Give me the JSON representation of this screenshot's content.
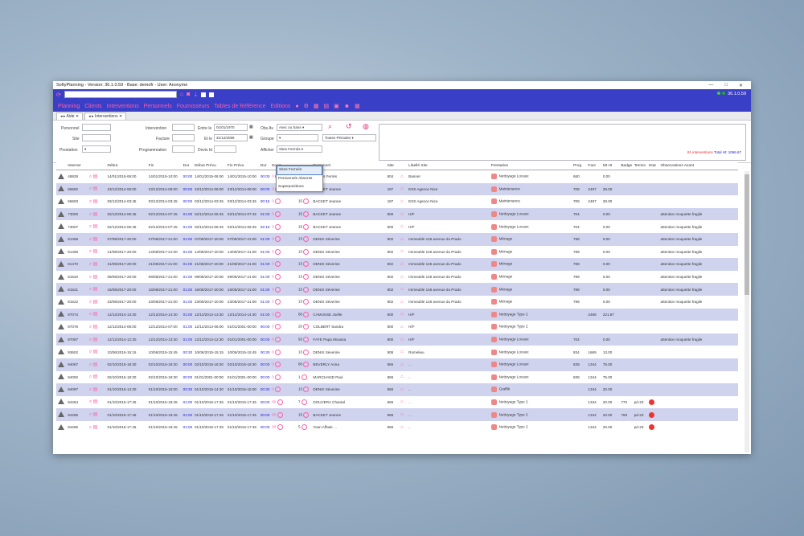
{
  "window": {
    "title": "SoftyPlanning - Version: 36.1.0.59 - Base: demofr - User: Anonyme",
    "version": "36.1.0.59"
  },
  "menu": [
    "Planning",
    "Clients",
    "Interventions",
    "Personnels",
    "Fournisseurs",
    "Tables de Référence",
    "Editions"
  ],
  "tabs": {
    "aide": "Aide",
    "interventions": "Interventions"
  },
  "filters": {
    "personnel": "Personnel",
    "site": "Site",
    "prestation": "Prestation",
    "intervention": "Intervention",
    "facture": "Facture",
    "programmation": "Programmation",
    "entre_le": "Entre le",
    "date_from": "01/01/1970",
    "et_le": "Et le",
    "date_to": "31/12/2099",
    "devis_id": "Devis Id",
    "obs_av": "Obs Av",
    "obs_av_value": "Avec ou Sans",
    "groupe": "Groupe",
    "periodes": "Toutes Périodes",
    "afficher": "Afficher",
    "afficher_value": "Sites Fermés"
  },
  "summary": {
    "count": "81 interventions",
    "total": "Total Ht: 1066.67"
  },
  "dropdown": [
    "Sites Fermés",
    "Personnels Absents",
    "Superpositions"
  ],
  "columns": [
    "",
    "Interner",
    "",
    "Début",
    "Fin",
    "Dur",
    "Début Prévu",
    "Fin Prévu",
    "Dur",
    "Ecart",
    "",
    "",
    "Personnel",
    "Site",
    "",
    "Libellé Site",
    "Prestation",
    "Prog",
    "Fact",
    "Mt Ht",
    "Badge",
    "Termin",
    "Etat",
    "Observations Avant"
  ],
  "rows": [
    {
      "id": "48828",
      "debut": "14/01/2015-06:00",
      "fin": "14/01/2015-10:00",
      "dur": "00:00",
      "dp": "14/01/2015-06:00",
      "fp": "14/01/2015-10:00",
      "dur2": "00:00",
      "ecart": "0",
      "n": "19",
      "pers": "Nicolas Ferrés",
      "site": "804",
      "lib": "Banner",
      "presta": "Nettoyage Locaux",
      "prog": "660",
      "fact": "",
      "mt": "0.00",
      "badge": "",
      "term": "",
      "obs": ""
    },
    {
      "id": "66692",
      "debut": "23/12/2014-06:00",
      "fin": "23/12/2014-06:00",
      "dur": "00:00",
      "dp": "23/12/2014-06:00",
      "fp": "23/12/2014-06:00",
      "dur2": "00:00",
      "ecart": "0",
      "n": "15",
      "pers": "BACKET Jeanne",
      "site": "187",
      "lib": "ESS Agence Nice",
      "presta": "Maintenance",
      "prog": "709",
      "fact": "2487",
      "mt": "28.00",
      "badge": "",
      "term": "",
      "obs": ""
    },
    {
      "id": "66693",
      "debut": "03/12/2014-03:45",
      "fin": "03/12/2014-03:45",
      "dur": "00:00",
      "dp": "03/12/2014-03:45",
      "fp": "03/12/2014-03:45",
      "dur2": "00:15",
      "ecart": "0",
      "n": "15",
      "pers": "BACKET Jeanne",
      "site": "187",
      "lib": "ESS Agence Nice",
      "presta": "Maintenance",
      "prog": "709",
      "fact": "2487",
      "mt": "28.00",
      "badge": "",
      "term": "",
      "obs": ""
    },
    {
      "id": "73000",
      "debut": "02/12/2014-06:45",
      "fin": "02/12/2014-07:45",
      "dur": "01:00",
      "dp": "02/12/2014-06:45",
      "fp": "02/12/2014-07:45",
      "dur2": "01:00",
      "ecart": "0",
      "n": "15",
      "pers": "BACKET Jeanne",
      "site": "800",
      "lib": "H/F",
      "presta": "Nettoyage Locaux",
      "prog": "704",
      "fact": "",
      "mt": "0.00",
      "badge": "",
      "term": "",
      "obs": "attention moquette fragile"
    },
    {
      "id": "73007",
      "debut": "02/12/2014-06:45",
      "fin": "02/12/2014-07:45",
      "dur": "01:00",
      "dp": "02/12/2014-06:45",
      "fp": "02/12/2014-06:45",
      "dur2": "02:15",
      "ecart": "0",
      "n": "15",
      "pers": "BACKET Jeanne",
      "site": "800",
      "lib": "H/F",
      "presta": "Nettoyage Locaux",
      "prog": "704",
      "fact": "",
      "mt": "0.00",
      "badge": "",
      "term": "",
      "obs": "attention moquette fragile"
    },
    {
      "id": "81468",
      "debut": "07/08/2017-20:00",
      "fin": "07/08/2017-21:00",
      "dur": "01:00",
      "dp": "07/08/2017-20:00",
      "fp": "07/08/2017-21:00",
      "dur2": "01:00",
      "ecart": "0",
      "n": "13",
      "pers": "DENIS Séverine",
      "site": "802",
      "lib": "Immeuble 145 avenue du Prado",
      "presta": "Ménage",
      "prog": "799",
      "fact": "",
      "mt": "0.00",
      "badge": "",
      "term": "",
      "obs": "attention moquette fragile"
    },
    {
      "id": "81469",
      "debut": "14/08/2017-20:00",
      "fin": "14/08/2017-21:00",
      "dur": "01:00",
      "dp": "14/08/2017-20:00",
      "fp": "14/08/2017-21:00",
      "dur2": "01:00",
      "ecart": "0",
      "n": "13",
      "pers": "DENIS Séverine",
      "site": "802",
      "lib": "Immeuble 145 avenue du Prado",
      "presta": "Ménage",
      "prog": "799",
      "fact": "",
      "mt": "0.00",
      "badge": "",
      "term": "",
      "obs": "attention moquette fragile"
    },
    {
      "id": "81470",
      "debut": "21/08/2017-20:00",
      "fin": "21/08/2017-21:00",
      "dur": "01:00",
      "dp": "21/08/2017-20:00",
      "fp": "21/08/2017-21:00",
      "dur2": "01:00",
      "ecart": "0",
      "n": "13",
      "pers": "DENIS Séverine",
      "site": "802",
      "lib": "Immeuble 145 avenue du Prado",
      "presta": "Ménage",
      "prog": "799",
      "fact": "",
      "mt": "0.00",
      "badge": "",
      "term": "",
      "obs": "attention moquette fragile"
    },
    {
      "id": "81520",
      "debut": "09/08/2017-20:00",
      "fin": "09/08/2017-21:00",
      "dur": "01:00",
      "dp": "09/08/2017-20:00",
      "fp": "09/08/2017-21:00",
      "dur2": "01:00",
      "ecart": "0",
      "n": "13",
      "pers": "DENIS Séverine",
      "site": "802",
      "lib": "Immeuble 145 avenue du Prado",
      "presta": "Ménage",
      "prog": "799",
      "fact": "",
      "mt": "0.00",
      "badge": "",
      "term": "",
      "obs": "attention moquette fragile"
    },
    {
      "id": "81521",
      "debut": "16/08/2017-20:00",
      "fin": "16/08/2017-21:00",
      "dur": "01:00",
      "dp": "16/08/2017-20:00",
      "fp": "16/08/2017-21:00",
      "dur2": "01:00",
      "ecart": "0",
      "n": "13",
      "pers": "DENIS Séverine",
      "site": "802",
      "lib": "Immeuble 145 avenue du Prado",
      "presta": "Ménage",
      "prog": "799",
      "fact": "",
      "mt": "0.00",
      "badge": "",
      "term": "",
      "obs": "attention moquette fragile"
    },
    {
      "id": "81522",
      "debut": "23/08/2017-20:00",
      "fin": "23/08/2017-21:00",
      "dur": "01:00",
      "dp": "23/08/2017-20:00",
      "fp": "23/08/2017-21:00",
      "dur2": "01:00",
      "ecart": "0",
      "n": "13",
      "pers": "DENIS Séverine",
      "site": "802",
      "lib": "Immeuble 145 avenue du Prado",
      "presta": "Ménage",
      "prog": "799",
      "fact": "",
      "mt": "0.00",
      "badge": "",
      "term": "",
      "obs": "attention moquette fragile"
    },
    {
      "id": "87074",
      "debut": "12/12/2014-13:30",
      "fin": "12/12/2014-14:30",
      "dur": "01:00",
      "dp": "12/12/2014-13:30",
      "fp": "12/12/2014-14:30",
      "dur2": "01:00",
      "ecart": "0",
      "n": "80",
      "pers": "CAMUSSE Joëlle",
      "site": "800",
      "lib": "H/F",
      "presta": "Nettoyage Type 2",
      "prog": "",
      "fact": "2488",
      "mt": "221.87",
      "badge": "",
      "term": "",
      "obs": ""
    },
    {
      "id": "87076",
      "debut": "12/12/2014-06:00",
      "fin": "12/12/2014-07:00",
      "dur": "01:00",
      "dp": "12/12/2014-06:00",
      "fp": "01/01/2001-00:00",
      "dur2": "00:00",
      "ecart": "0",
      "n": "20",
      "pers": "COLBERT Sandra",
      "site": "800",
      "lib": "H/F",
      "presta": "Nettoyage Type 2",
      "prog": "",
      "fact": "",
      "mt": "",
      "badge": "",
      "term": "",
      "obs": ""
    },
    {
      "id": "87087",
      "debut": "12/12/2014-12:30",
      "fin": "12/12/2014-13:30",
      "dur": "01:00",
      "dp": "12/12/2014-12:30",
      "fp": "01/01/2001-00:00",
      "dur2": "00:00",
      "ecart": "0",
      "n": "92",
      "pers": "FAYE Papa Moussa",
      "site": "800",
      "lib": "H/F",
      "presta": "Nettoyage Locaux",
      "prog": "704",
      "fact": "",
      "mt": "0.00",
      "badge": "",
      "term": "",
      "obs": "attention moquette fragile"
    },
    {
      "id": "93602",
      "debut": "10/06/2015-15:15",
      "fin": "10/06/2015-15:45",
      "dur": "00:30",
      "dp": "10/06/2015-15:15",
      "fp": "10/06/2015-15:45",
      "dur2": "00:30",
      "ecart": "0",
      "n": "13",
      "pers": "DENIS Séverine",
      "site": "806",
      "lib": "Romelieu",
      "presta": "Nettoyage Locaux",
      "prog": "834",
      "fact": "1669",
      "mt": "13.00",
      "badge": "",
      "term": "",
      "obs": ""
    },
    {
      "id": "94067",
      "debut": "02/10/2015-18:30",
      "fin": "02/10/2015-18:30",
      "dur": "00:00",
      "dp": "02/10/2015-18:30",
      "fp": "02/10/2015-18:30",
      "dur2": "00:00",
      "ecart": "0",
      "n": "80",
      "pers": "BEVERLY Anna",
      "site": "866",
      "lib": "..",
      "presta": "Nettoyage Locaux",
      "prog": "839",
      "fact": "1344",
      "mt": "75.00",
      "badge": "",
      "term": "",
      "obs": ""
    },
    {
      "id": "94092",
      "debut": "02/10/2015-18:30",
      "fin": "02/10/2015-18:30",
      "dur": "00:00",
      "dp": "01/01/2001-00:00",
      "fp": "01/01/2001-00:00",
      "dur2": "00:00",
      "ecart": "0",
      "n": "1",
      "pers": "MARCHAND Paul",
      "site": "866",
      "lib": "..",
      "presta": "Nettoyage Locaux",
      "prog": "839",
      "fact": "1344",
      "mt": "75.00",
      "badge": "",
      "term": "",
      "obs": ""
    },
    {
      "id": "94097",
      "debut": "01/10/2015-14:30",
      "fin": "01/10/2015-15:00",
      "dur": "00:30",
      "dp": "01/10/2015-14:30",
      "fp": "01/10/2015-15:00",
      "dur2": "00:30",
      "ecart": "0",
      "n": "13",
      "pers": "DENIS Séverine",
      "site": "866",
      "lib": "..",
      "presta": "Graffiti",
      "prog": "",
      "fact": "1344",
      "mt": "20.00",
      "badge": "",
      "term": "",
      "obs": ""
    },
    {
      "id": "94284",
      "debut": "01/10/2015-17:45",
      "fin": "01/10/2015-18:45",
      "dur": "01:00",
      "dp": "01/10/2015-17:45",
      "fp": "01/10/2015-17:45",
      "dur2": "00:00",
      "ecart": "60",
      "n": "7",
      "pers": "DOUVERA Chantal",
      "site": "866",
      "lib": "..",
      "presta": "Nettoyage Type 2",
      "prog": "",
      "fact": "1344",
      "mt": "20.00",
      "badge": "770",
      "term": "pd-23",
      "obs": ""
    },
    {
      "id": "94285",
      "debut": "01/10/2015-17:45",
      "fin": "01/10/2015-18:45",
      "dur": "01:00",
      "dp": "01/10/2015-17:45",
      "fp": "01/10/2015-17:45",
      "dur2": "00:00",
      "ecart": "60",
      "n": "15",
      "pers": "BACKET Jeanne",
      "site": "866",
      "lib": "..",
      "presta": "Nettoyage Type 2",
      "prog": "",
      "fact": "1344",
      "mt": "20.00",
      "badge": "769",
      "term": "pd-23",
      "obs": ""
    },
    {
      "id": "94286",
      "debut": "01/10/2015-17:45",
      "fin": "01/10/2015-18:45",
      "dur": "01:00",
      "dp": "01/10/2015-17:45",
      "fp": "01/10/2015-17:45",
      "dur2": "00:00",
      "ecart": "60",
      "n": "5",
      "pers": "Yoan Affaite ...",
      "site": "866",
      "lib": "..",
      "presta": "Nettoyage Type 2",
      "prog": "",
      "fact": "1344",
      "mt": "20.00",
      "badge": "",
      "term": "pd-23",
      "obs": ""
    }
  ]
}
